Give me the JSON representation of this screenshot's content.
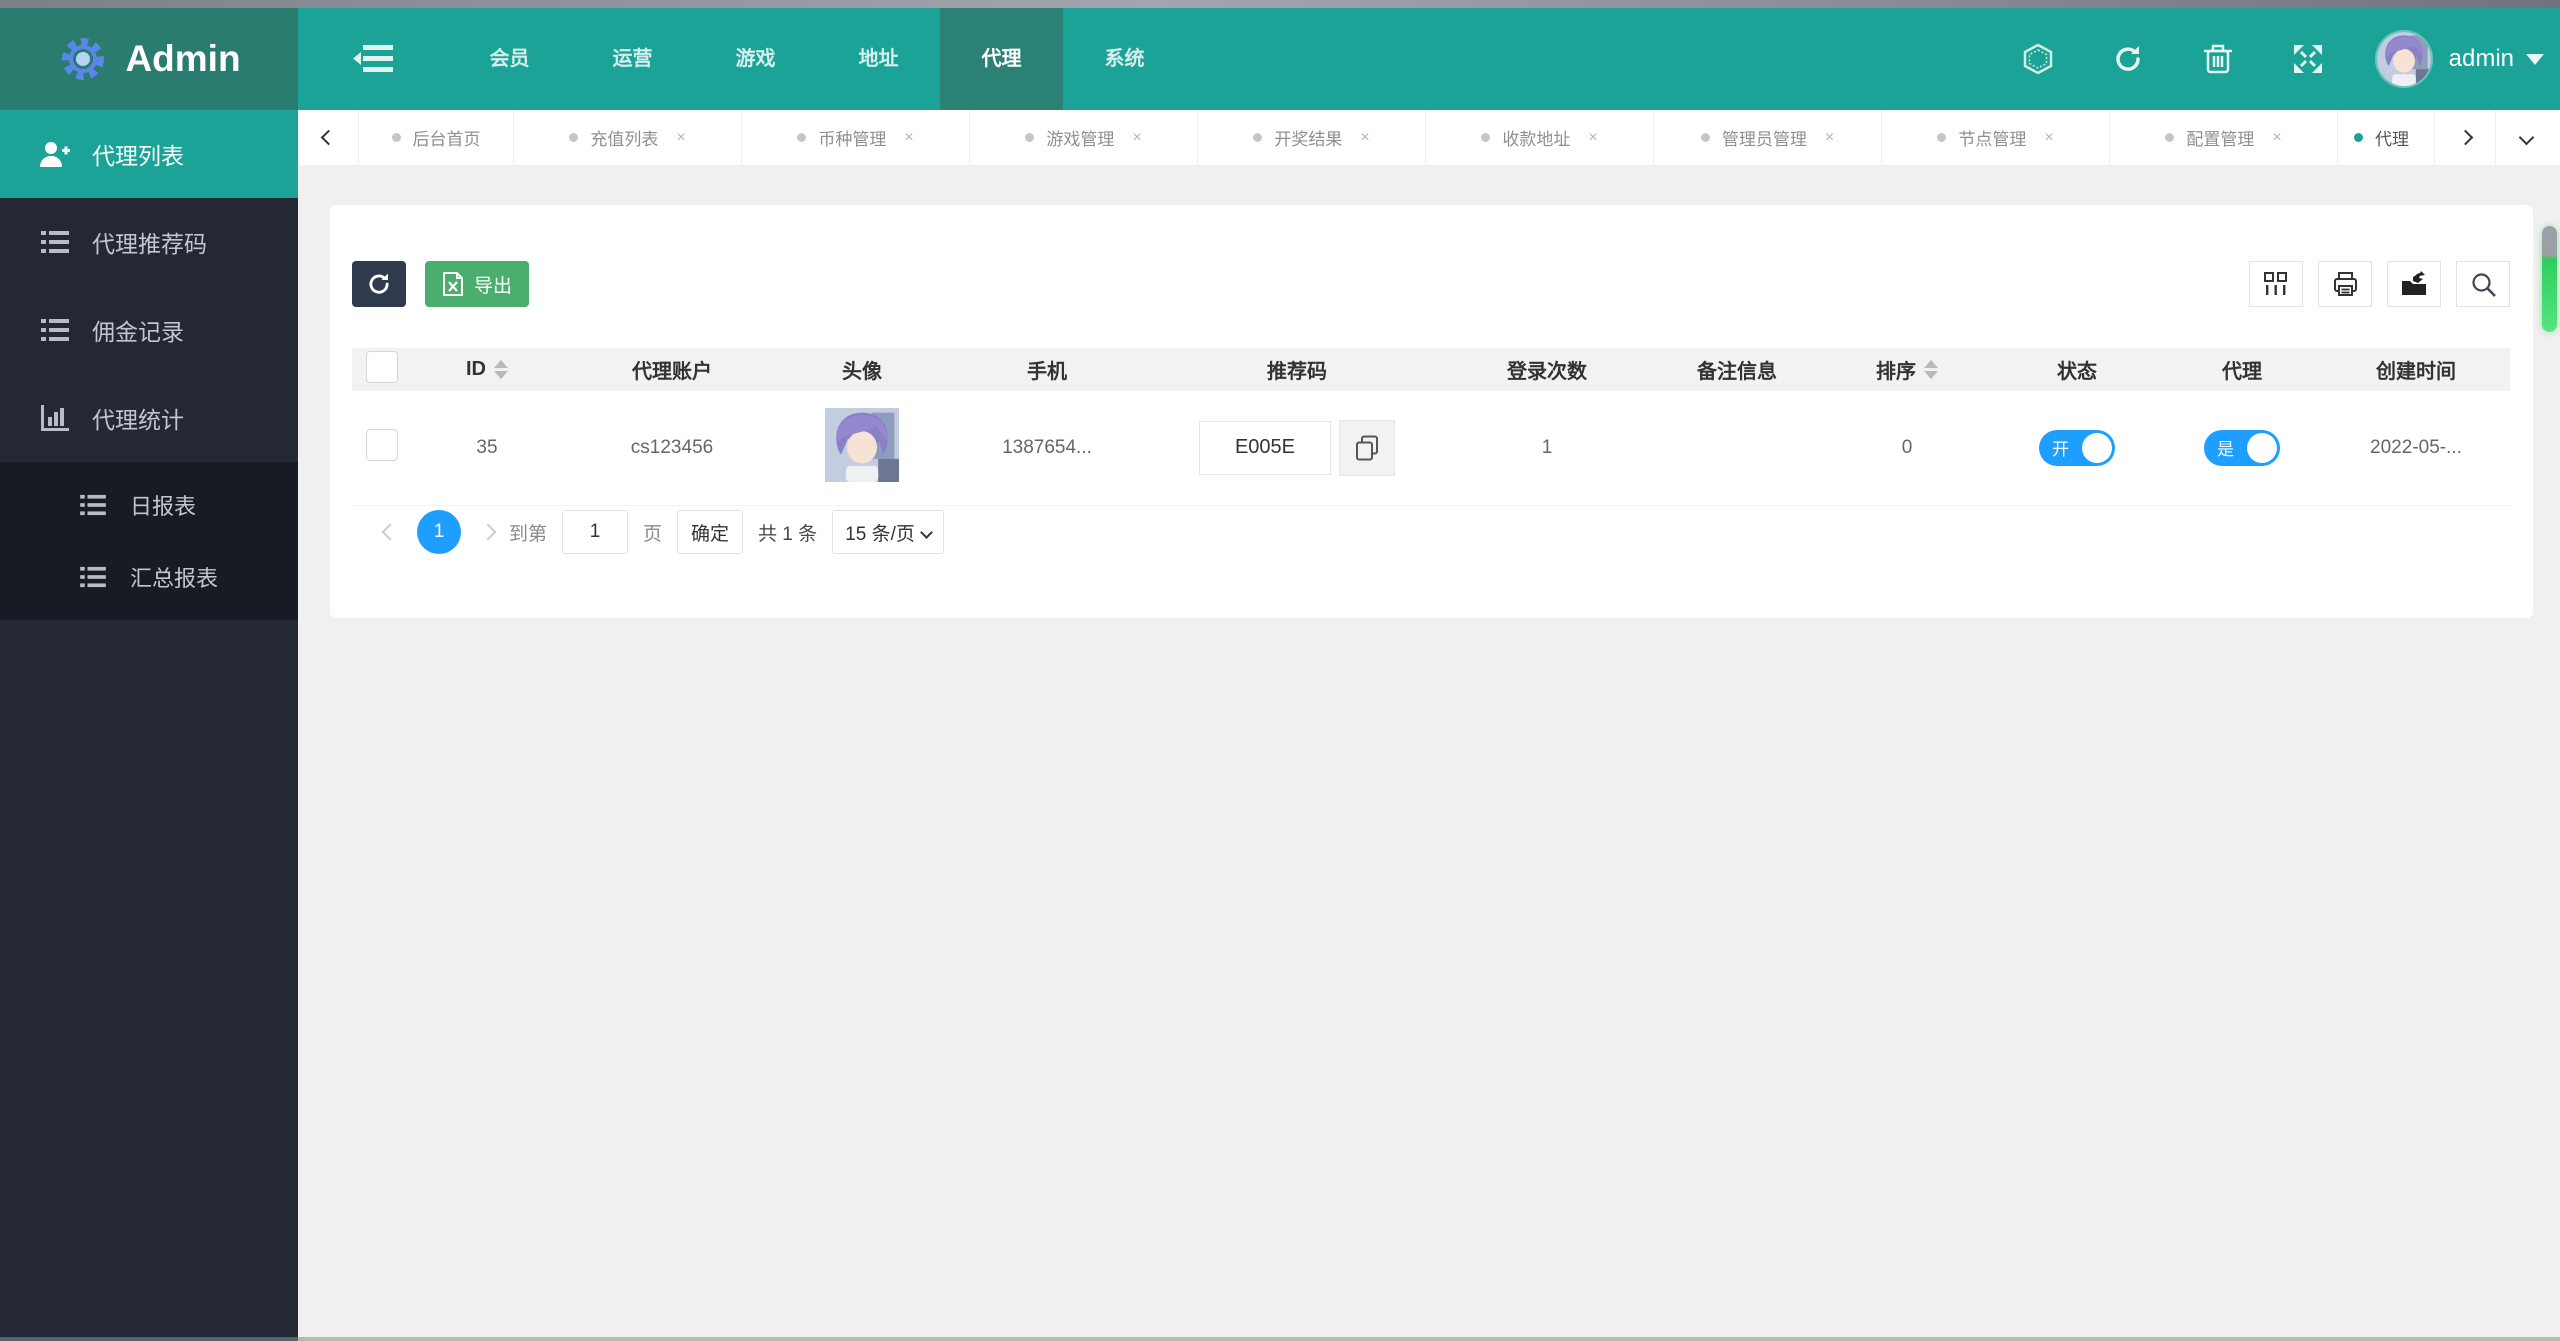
{
  "brand": {
    "title": "Admin"
  },
  "topnav": {
    "items": [
      {
        "label": "会员"
      },
      {
        "label": "运营"
      },
      {
        "label": "游戏"
      },
      {
        "label": "地址"
      },
      {
        "label": "代理",
        "active": true
      },
      {
        "label": "系统"
      }
    ],
    "user": "admin"
  },
  "sidebar": {
    "items": [
      {
        "label": "代理列表",
        "icon": "user-plus-icon",
        "active": true
      },
      {
        "label": "代理推荐码",
        "icon": "list-icon"
      },
      {
        "label": "佣金记录",
        "icon": "list-icon"
      },
      {
        "label": "代理统计",
        "icon": "bar-chart-icon"
      }
    ],
    "subitems": [
      {
        "label": "日报表",
        "icon": "list-icon"
      },
      {
        "label": "汇总报表",
        "icon": "list-icon"
      }
    ]
  },
  "tabs": {
    "close_glyph": "×",
    "items": [
      {
        "label": "后台首页",
        "closable": false
      },
      {
        "label": "充值列表",
        "closable": true
      },
      {
        "label": "币种管理",
        "closable": true
      },
      {
        "label": "游戏管理",
        "closable": true
      },
      {
        "label": "开奖结果",
        "closable": true
      },
      {
        "label": "收款地址",
        "closable": true
      },
      {
        "label": "管理员管理",
        "closable": true
      },
      {
        "label": "节点管理",
        "closable": true
      },
      {
        "label": "配置管理",
        "closable": true
      },
      {
        "label": "代理",
        "closable": false,
        "active": true
      }
    ]
  },
  "toolbar": {
    "export_label": "导出"
  },
  "table": {
    "columns": [
      "ID",
      "代理账户",
      "头像",
      "手机",
      "推荐码",
      "登录次数",
      "备注信息",
      "排序",
      "状态",
      "代理",
      "创建时间"
    ],
    "rows": [
      {
        "id": "35",
        "account": "cs123456",
        "phone": "1387654...",
        "code": "E005E",
        "logins": "1",
        "remark": "",
        "sort": "0",
        "status_label": "开",
        "agent_label": "是",
        "created": "2022-05-..."
      }
    ]
  },
  "pagination": {
    "current_page": "1",
    "goto_label": "到第",
    "page_value": "1",
    "page_suffix": "页",
    "confirm_label": "确定",
    "total_label": "共 1 条",
    "per_page_label": "15 条/页"
  },
  "colors": {
    "accent_teal": "#1aa396",
    "navbar_dark_teal": "#2a7c6e",
    "sidebar_dark": "#242834",
    "toggle_blue": "#1e9fff",
    "export_green": "#4cae6e",
    "refresh_dark": "#2f3a4d"
  },
  "icons": {
    "topnav_right": [
      "hexagon-icon",
      "refresh-icon",
      "trash-icon",
      "fullscreen-icon"
    ],
    "card_toolbar_right": [
      "columns-icon",
      "printer-icon",
      "export-file-icon",
      "search-icon"
    ]
  }
}
